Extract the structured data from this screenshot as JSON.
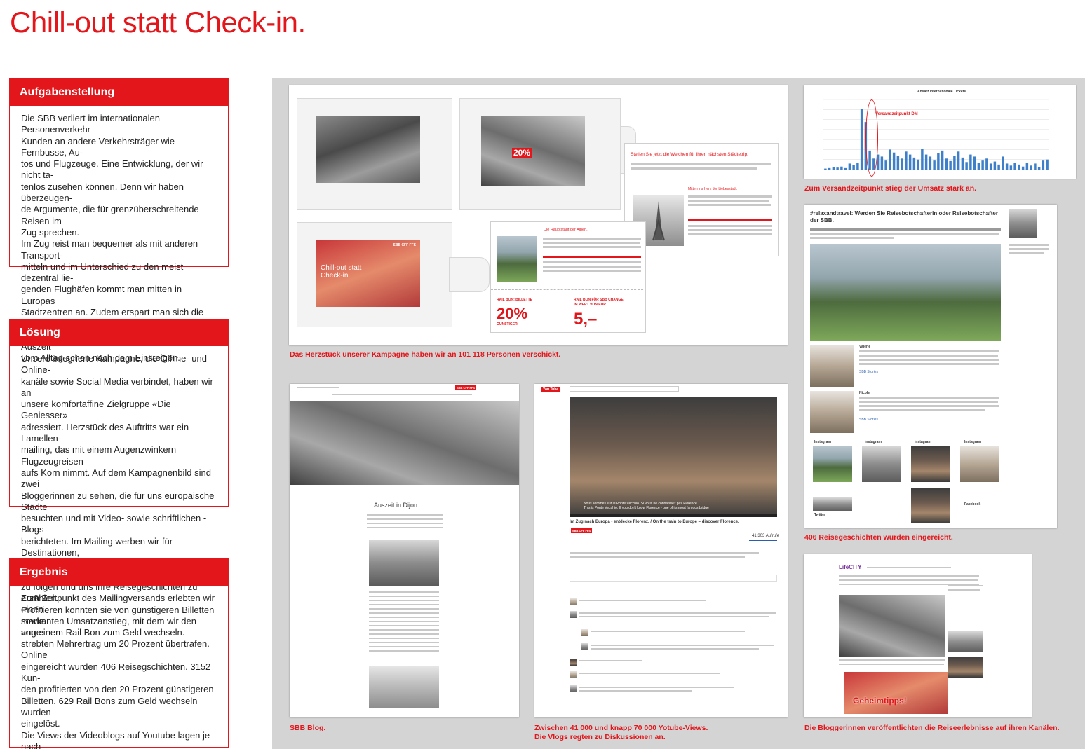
{
  "title": "Chill-out statt Check-in.",
  "sections": {
    "task": {
      "heading": "Aufgabenstellung",
      "text": "Die SBB verliert im internationalen Personenverkehr\nKunden an andere Verkehrsträger wie Fernbusse, Au-\ntos und Flugzeuge. Eine Entwicklung, der wir nicht ta-\ntenlos zusehen können. Denn wir haben überzeugen-\nde Argumente, die für grenzüberschreitende Reisen im\nZug sprechen.\nIm Zug reist man bequemer als mit anderen Transport-\nmitteln und im Unterschied zu den meist dezentral lie-\ngenden Flughäfen kommt man mitten in Europas\nStadtzentren an. Zudem erspart man sich die Schlan-\ngen am Check-in-Schalter. Im Zug beginnt die Auszeit\nvom Alltag schon nach dem Einsteigen."
    },
    "solution": {
      "heading": "Lösung",
      "text": "Unsere integrierte Kampagne, die Offline- und Online-\nkanäle sowie Social Media verbindet, haben wir an\nunsere komfortaffine Zielgruppe «Die Geniesser»\n adressiert. Herzstück des Auftritts war ein Lamellen-\nmailing, das mit einem Augenzwinkern Flugzeugreisen\naufs Korn nimmt. Auf dem Kampagnenbild sind zwei\nBloggerinnen zu sehen, die für uns europäische Städte\nbesuchten und mit Video- sowie schriftlichen -Blogs\nberichteten. Im Mailing werben wir für Destinationen,\nfordern unsere Zielgruppe auf, unseren Bloggerinnen\nzu folgen und uns ihre Reisegeschichten zu erzählen.\nProfitieren konnten sie von günstigeren Billetten sowie\nvon einem Rail Bon zum Geld wechseln."
    },
    "result": {
      "heading": "Ergebnis",
      "text": "Zum Zeitpunkt des Mailingversands erlebten wir einen\nmarkanten Umsatzanstieg, mit dem wir den ange-\nstrebten Mehrertrag um 20 Prozent übertrafen. Online\neingereicht wurden 406 Reisegschichten. 3152 Kun-\nden profitierten von den 20 Prozent günstigeren\nBilletten. 629 Rail Bons zum Geld wechseln wurden\neingelöst.\nDie Views der Videoblogs auf Youtube lagen je nach\nDestination zwischen 41 000 und knapp 70 000.\nDie Blogs wurden auf der SBB-eigenen Seite sbb.ch/\nrelaxandtravel sowie auf den eigenen Kanälen der\nBloggerinnen veröffentlicht, Fragen dazu von unserem\nhausinternen Social-Media-Team beantwortet."
    }
  },
  "captions": {
    "mailing": "Das Herzstück unserer Kampagne haben wir an 101 118 Personen verschickt.",
    "chart": "Zum Versandzeitpunkt stieg der Umsatz stark an.",
    "blog": "SBB Blog.",
    "youtube": "Zwischen 41 000 und knapp 70 000 Yotube-Views.\nDie Vlogs regten zu Diskussionen an.",
    "stories": "406 Reisegeschichten wurden eingereicht.",
    "bloggers": "Die Bloggerinnen veröffentlichten die Reiseerlebnisse auf ihren Kanälen."
  },
  "mailing": {
    "card_headline": "Stellen Sie jetzt die Weichen für Ihren nächsten Städtetrip.",
    "card_sub1": "Mitten ins Herz der Liebesstadt.",
    "card_sub2": "Die Hauptstadt der Alpen.",
    "cover_text": "Chill-out statt Check-in.",
    "bon1_label": "RAIL BON: BILLETTE",
    "bon1_value": "20%",
    "bon1_sub": "GÜNSTIGER",
    "bon2_label": "RAIL BON FÜR SBB CHANGE",
    "bon2_sub": "IM WERT VON EUR",
    "bon2_value": "5,–",
    "brand": "SBB CFF FFS"
  },
  "chart": {
    "title": "Absatz internationale Tickets",
    "annotation": "Versandzeitpunkt DM"
  },
  "chart_data": {
    "type": "bar",
    "title": "Absatz internationale Tickets",
    "values": [
      2,
      3,
      5,
      4,
      6,
      3,
      12,
      9,
      14,
      121,
      95,
      38,
      22,
      30,
      26,
      18,
      40,
      34,
      28,
      22,
      36,
      30,
      24,
      20,
      42,
      30,
      26,
      18,
      33,
      38,
      22,
      17,
      28,
      36,
      24,
      15,
      30,
      26,
      14,
      18,
      22,
      12,
      16,
      10,
      26,
      12,
      8,
      14,
      10,
      6,
      13,
      8,
      12,
      5,
      18,
      20
    ],
    "ylim": [
      0,
      140
    ]
  },
  "blog": {
    "post_title": "Auszeit in Dijon."
  },
  "youtube": {
    "logo": "You Tube",
    "video_title": "Im Zug nach Europa - entdecke Florenz. / On the train to Europe – discover Florence.",
    "views": "41 303 Aufrufe",
    "subtitle": "Nous sommes sur le Ponte Vecchio. Si vous ne connaissez pas Florence\nThis is Ponte Vecchio. If you don't know Florence - one of its most famous bridge"
  },
  "stories": {
    "heading": "#relaxandtravel: Werden Sie Reisebotschafterin oder Reisebotschafter der SBB.",
    "author1": "Valerie",
    "author2": "Nicole",
    "link": "SBB Stories",
    "instagram": "Instagram",
    "twitter": "Twitter",
    "facebook": "Facebook"
  },
  "bloggers": {
    "site": "LifeCITY",
    "banner": "Geheimtipps!"
  }
}
